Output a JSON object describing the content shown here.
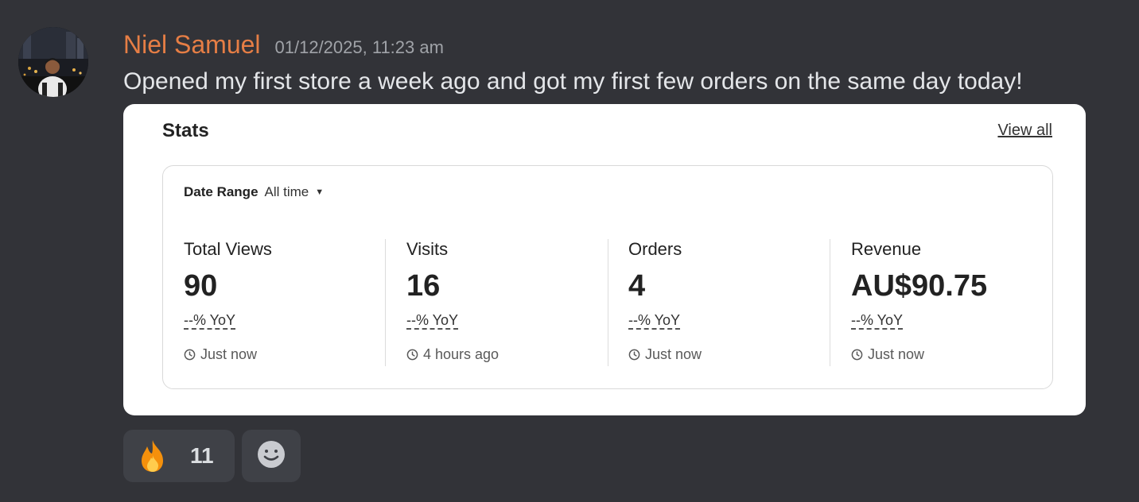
{
  "message": {
    "username": "Niel Samuel",
    "timestamp": "01/12/2025, 11:23 am",
    "text": "Opened my first store a week ago and got my first few orders on the same day today!",
    "username_color": "#e67e45"
  },
  "embed": {
    "title": "Stats",
    "view_all_label": "View all",
    "date_range_label": "Date Range",
    "date_range_value": "All time",
    "metrics": [
      {
        "label": "Total Views",
        "value": "90",
        "yoy": "--% YoY",
        "time": "Just now"
      },
      {
        "label": "Visits",
        "value": "16",
        "yoy": "--% YoY",
        "time": "4 hours ago"
      },
      {
        "label": "Orders",
        "value": "4",
        "yoy": "--% YoY",
        "time": "Just now"
      },
      {
        "label": "Revenue",
        "value": "AU$90.75",
        "yoy": "--% YoY",
        "time": "Just now"
      }
    ]
  },
  "reactions": [
    {
      "emoji": "fire-icon",
      "count": "11"
    },
    {
      "emoji": "add-reaction-icon",
      "count": ""
    }
  ],
  "colors": {
    "background": "#323338",
    "embed_background": "#ffffff",
    "reaction_background": "#3f4147"
  }
}
